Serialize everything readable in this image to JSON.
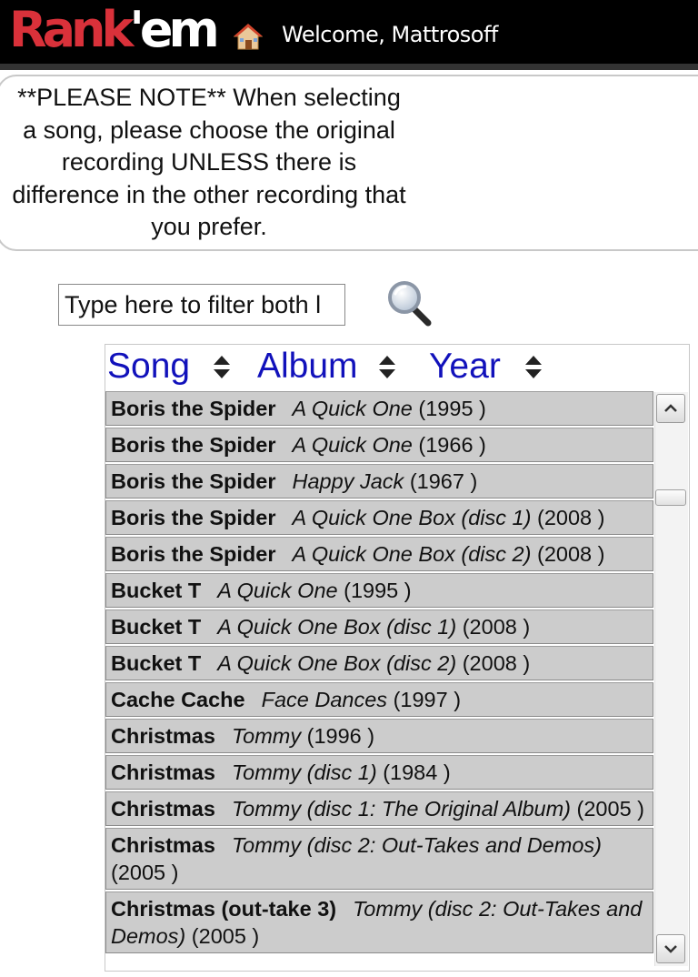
{
  "header": {
    "logo_rank": "Rank",
    "logo_em": "'em",
    "welcome": "Welcome, Mattrosoff"
  },
  "note": {
    "text": "**PLEASE NOTE** When selecting a song, please choose the original recording UNLESS there is difference in the other recording that you prefer."
  },
  "filter": {
    "value": "Type here to filter both l"
  },
  "table": {
    "columns": [
      "Song",
      "Album",
      "Year"
    ],
    "rows": [
      {
        "song": "Boris the Spider",
        "album": "A Quick One",
        "year": "(1995 )"
      },
      {
        "song": "Boris the Spider",
        "album": "A Quick One",
        "year": "(1966 )"
      },
      {
        "song": "Boris the Spider",
        "album": "Happy Jack",
        "year": "(1967 )"
      },
      {
        "song": "Boris the Spider",
        "album": "A Quick One Box (disc 1)",
        "year": "(2008 )"
      },
      {
        "song": "Boris the Spider",
        "album": "A Quick One Box (disc 2)",
        "year": "(2008 )"
      },
      {
        "song": "Bucket T",
        "album": "A Quick One",
        "year": "(1995 )"
      },
      {
        "song": "Bucket T",
        "album": "A Quick One Box (disc 1)",
        "year": "(2008 )"
      },
      {
        "song": "Bucket T",
        "album": "A Quick One Box (disc 2)",
        "year": "(2008 )"
      },
      {
        "song": "Cache Cache",
        "album": "Face Dances",
        "year": "(1997 )"
      },
      {
        "song": "Christmas",
        "album": "Tommy",
        "year": "(1996 )"
      },
      {
        "song": "Christmas",
        "album": "Tommy (disc 1)",
        "year": "(1984 )"
      },
      {
        "song": "Christmas",
        "album": "Tommy (disc 1: The Original Album)",
        "year": "(2005 )"
      },
      {
        "song": "Christmas",
        "album": "Tommy (disc 2: Out-Takes and Demos)",
        "year": "(2005 )"
      },
      {
        "song": "Christmas (out-take 3)",
        "album": "Tommy (disc 2: Out-Takes and Demos)",
        "year": "(2005 )"
      }
    ]
  },
  "colors": {
    "topbar": "#000000",
    "logo_red": "#d9313a",
    "header_link": "#1111bb",
    "row_bg": "#cccccc"
  },
  "icons": [
    "home-icon",
    "search-icon",
    "sort-icon",
    "scroll-up-icon",
    "scroll-down-icon"
  ]
}
